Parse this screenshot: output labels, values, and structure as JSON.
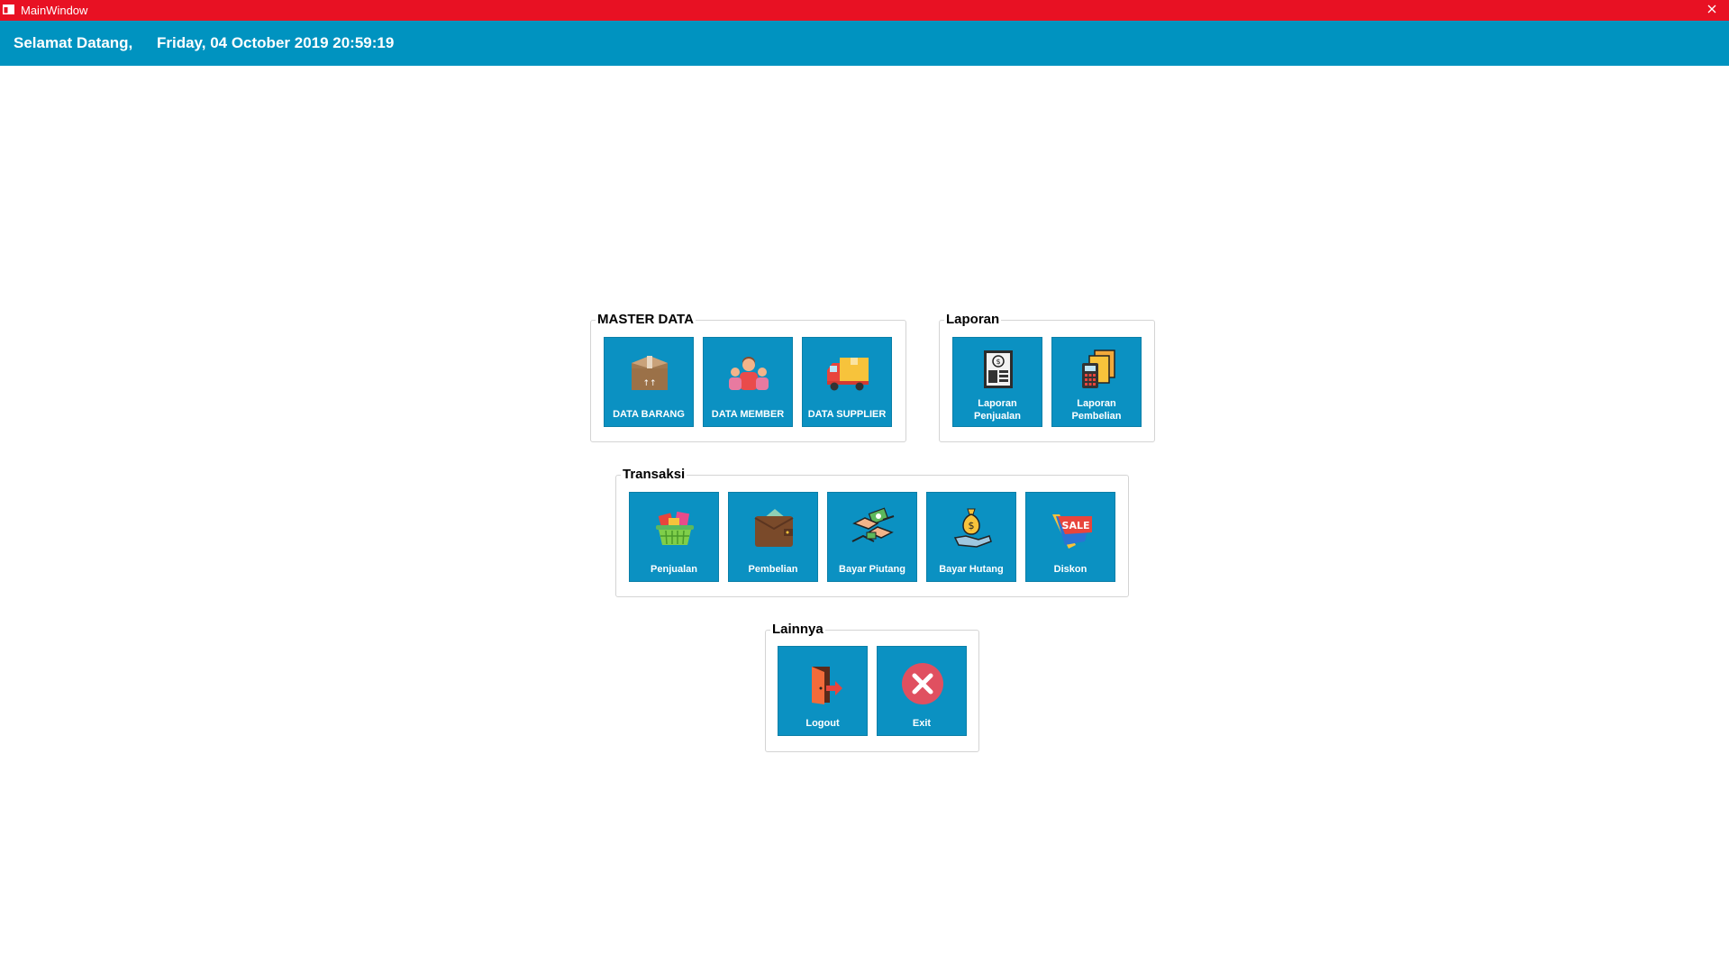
{
  "window": {
    "title": "MainWindow"
  },
  "header": {
    "welcome": "Selamat Datang,",
    "datetime": "Friday, 04 October 2019 20:59:19"
  },
  "colors": {
    "titlebar": "#e81123",
    "header": "#0093c0",
    "tile": "#0b91c2"
  },
  "groups": {
    "master": {
      "label": "MASTER DATA",
      "items": [
        {
          "label": "DATA BARANG",
          "icon": "box-icon"
        },
        {
          "label": "DATA MEMBER",
          "icon": "people-icon"
        },
        {
          "label": "DATA SUPPLIER",
          "icon": "truck-icon"
        }
      ]
    },
    "laporan": {
      "label": "Laporan",
      "items": [
        {
          "label": "Laporan Penjualan",
          "icon": "sales-report-icon"
        },
        {
          "label": "Laporan Pembelian",
          "icon": "purchase-report-icon"
        }
      ]
    },
    "transaksi": {
      "label": "Transaksi",
      "items": [
        {
          "label": "Penjualan",
          "icon": "basket-icon"
        },
        {
          "label": "Pembelian",
          "icon": "wallet-icon"
        },
        {
          "label": "Bayar Piutang",
          "icon": "handshake-money-icon"
        },
        {
          "label": "Bayar Hutang",
          "icon": "money-bag-hand-icon"
        },
        {
          "label": "Diskon",
          "icon": "sale-tag-icon"
        }
      ]
    },
    "lainnya": {
      "label": "Lainnya",
      "items": [
        {
          "label": "Logout",
          "icon": "logout-door-icon"
        },
        {
          "label": "Exit",
          "icon": "exit-icon"
        }
      ]
    }
  }
}
